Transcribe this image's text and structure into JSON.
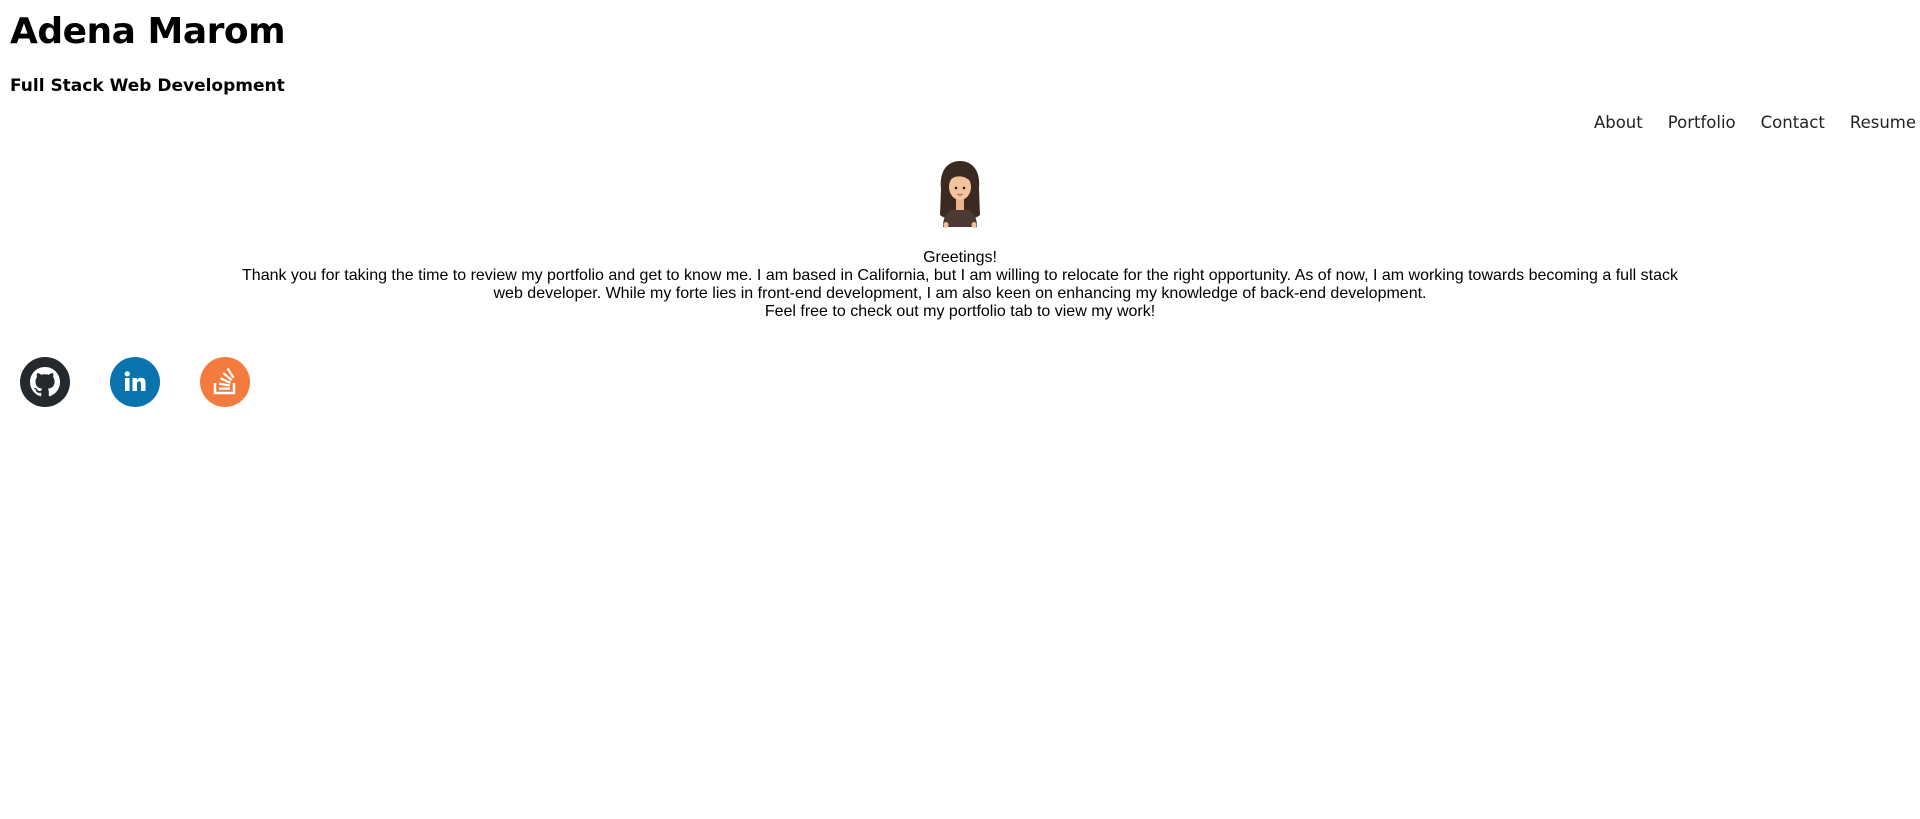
{
  "header": {
    "title": "Adena Marom",
    "subtitle": "Full Stack Web Development"
  },
  "nav": {
    "items": [
      {
        "label": "About"
      },
      {
        "label": "Portfolio"
      },
      {
        "label": "Contact"
      },
      {
        "label": "Resume"
      }
    ]
  },
  "main": {
    "avatar_icon": "woman-emoji-icon",
    "greeting": "Greetings!",
    "paragraph_1": "Thank you for taking the time to review my portfolio and get to know me. I am based in California, but I am willing to relocate for the right opportunity. As of now, I am working towards becoming a full stack web developer. While my forte lies in front-end development, I am also keen on enhancing my knowledge of back-end development.",
    "paragraph_2": "Feel free to check out my portfolio tab to view my work!"
  },
  "socials": [
    {
      "icon": "github-icon",
      "color": "#24292e"
    },
    {
      "icon": "linkedin-icon",
      "color": "#0a72ac"
    },
    {
      "icon": "stackoverflow-icon",
      "color": "#f47b3e"
    }
  ]
}
